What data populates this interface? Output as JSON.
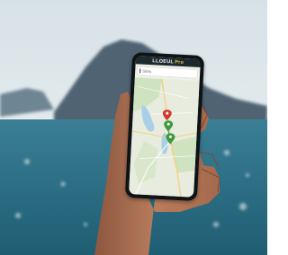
{
  "app": {
    "name": "LLOEUL",
    "name_suffix": "Pro",
    "search_label": "Sites"
  },
  "scene": {
    "subject": "hand-holding-phone",
    "background": "lake-and-mountain",
    "colors": {
      "sky": "#dfe8ec",
      "mountain": "#4d6170",
      "water": "#2f6f86",
      "skin": "#b47858"
    }
  },
  "map": {
    "pins": [
      {
        "color": "#3b9a3b",
        "icon": "map-pin-icon"
      },
      {
        "color": "#d03a2f",
        "icon": "map-pin-icon"
      },
      {
        "color": "#3b9a3b",
        "icon": "map-pin-icon"
      }
    ],
    "colors": {
      "land": "#e8ecdf",
      "park": "#cfe3c0",
      "water": "#a9cfe6",
      "road": "#f2d27a",
      "route": "#5c86b8"
    }
  }
}
